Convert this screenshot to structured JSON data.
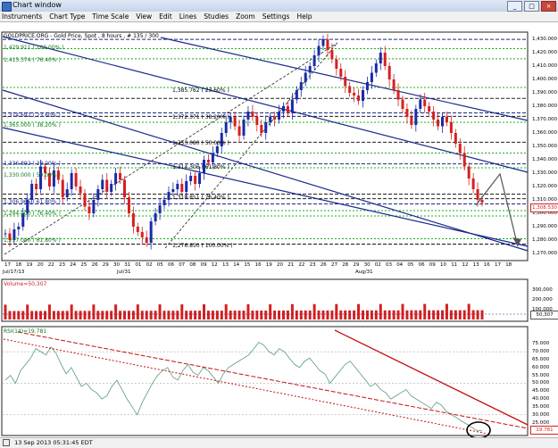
{
  "window": {
    "title": "Chart window",
    "minimize": "_",
    "maximize": "□",
    "close": "×"
  },
  "menu": [
    "Instruments",
    "Chart Type",
    "Time Scale",
    "View",
    "Edit",
    "Lines",
    "Studies",
    "Zoom",
    "Settings",
    "Help"
  ],
  "chart": {
    "header": "GOLDPRICE.ORG - Gold Price, Spot , 8 hours , # 135 / 300",
    "current_price": "1,308.530",
    "price_ticks": [
      "1,430.000",
      "1,420.000",
      "1,410.000",
      "1,400.000",
      "1,390.000",
      "1,380.000",
      "1,370.000",
      "1,360.000",
      "1,350.000",
      "1,340.000",
      "1,330.000",
      "1,320.000",
      "1,310.000",
      "1,300.000",
      "1,290.000",
      "1,280.000",
      "1,270.000"
    ],
    "fib_labels": [
      "1,385.762 ( 23.60% )",
      "1,372.371 ( 38.20% )",
      "1,353.080 ( 50.00% )",
      "1,314.306 ( 61.80% )",
      "1,310.851 ( 76.40% )",
      "1,276.850 ( 100.00% )"
    ],
    "left_labels": [
      "1,429.911 ( 100.00% )",
      "1,415.374 ( 76.40% )",
      "1,374.692 ( 23.60% )",
      "1,365.000 ( 38.20% )",
      "1,336.892 ( 38.20% )",
      "1,330.000 ( 50.00% )",
      "1,306.965 ( 61.80% )",
      "1,294.000 ( 76.40% )",
      "1,277.040 ( 61.80% )"
    ],
    "day_labels": [
      "17",
      "18",
      "19",
      "20",
      "22",
      "23",
      "24",
      "25",
      "26",
      "29",
      "30",
      "31",
      "01",
      "02",
      "05",
      "06",
      "07",
      "08",
      "09",
      "12",
      "13",
      "14",
      "15",
      "16",
      "19",
      "20",
      "21",
      "22",
      "23",
      "26",
      "27",
      "28",
      "29",
      "30",
      "02",
      "03",
      "04",
      "05",
      "06",
      "09",
      "10",
      "11",
      "12",
      "13",
      "16",
      "17",
      "18"
    ],
    "month_labels": [
      "Jul/17/13",
      "Jul/31",
      "Aug/31"
    ]
  },
  "volume": {
    "header": "Volume=50,307",
    "ticks": [
      "300,000",
      "200,000",
      "100,000"
    ],
    "current": "50,307"
  },
  "oscillator": {
    "header": "RSI(14)=19.781",
    "ticks": [
      "75.000",
      "70.000",
      "65.000",
      "60.000",
      "55.000",
      "50.000",
      "45.000",
      "40.000",
      "35.000",
      "30.000",
      "25.000",
      "20.000"
    ],
    "current": "19.781"
  },
  "status": {
    "timestamp": "13 Sep 2013 05:31:45 EDT"
  },
  "colors": {
    "candle_up": "#1a2aa8",
    "candle_down": "#d62020",
    "fib_blue": "#1a2a8c",
    "fib_green": "#19b019",
    "channel": "#1a2a8c",
    "trend_red": "#c41010",
    "rsi": "#5a9a7a"
  }
}
